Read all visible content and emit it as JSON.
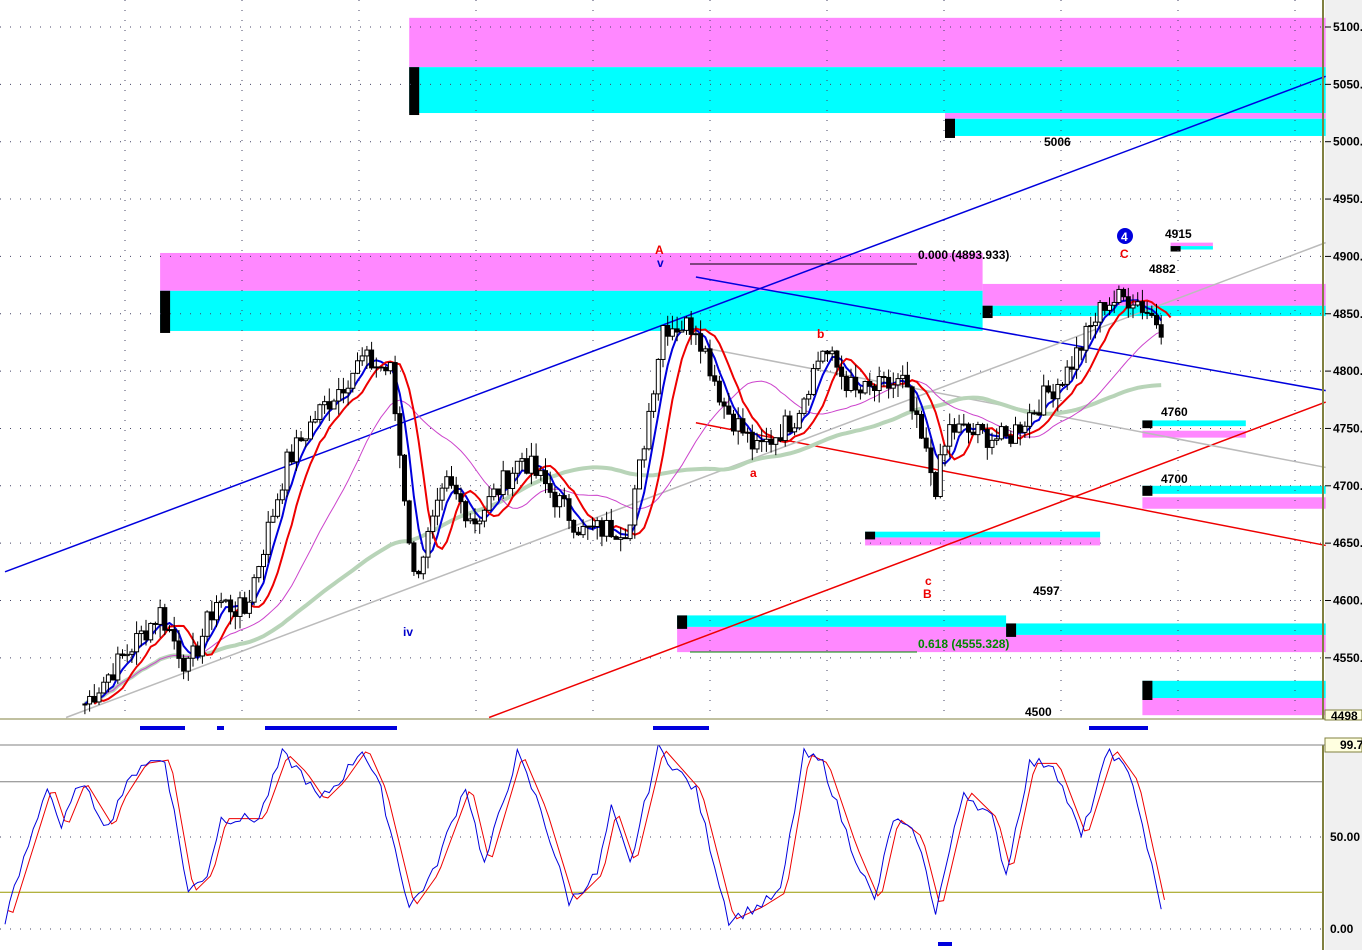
{
  "chart_data": {
    "type": "candlestick",
    "title": "",
    "price_axis": {
      "ylim": [
        4498,
        5108
      ],
      "ticks": [
        5100,
        5050,
        5000,
        4950,
        4900,
        4850,
        4800,
        4750,
        4700,
        4650,
        4600,
        4550
      ],
      "tick_labels": [
        "5100.",
        "5050.",
        "5000.",
        "4950.",
        "4900.",
        "4850.",
        "4800.",
        "4750.",
        "4700.",
        "4650.",
        "4600.",
        "4550."
      ],
      "last_label": "4498"
    },
    "price_waypoints": [
      [
        17,
        4510
      ],
      [
        33,
        4590
      ],
      [
        39,
        4540
      ],
      [
        45,
        4600
      ],
      [
        51,
        4590
      ],
      [
        60,
        4720
      ],
      [
        66,
        4760
      ],
      [
        76,
        4810
      ],
      [
        82,
        4800
      ],
      [
        87,
        4620
      ],
      [
        94,
        4700
      ],
      [
        100,
        4670
      ],
      [
        110,
        4725
      ],
      [
        123,
        4660
      ],
      [
        133,
        4665
      ],
      [
        140,
        4840
      ],
      [
        147,
        4840
      ],
      [
        153,
        4770
      ],
      [
        160,
        4730
      ],
      [
        168,
        4760
      ],
      [
        174,
        4820
      ],
      [
        181,
        4780
      ],
      [
        191,
        4790
      ],
      [
        198,
        4700
      ],
      [
        201,
        4750
      ],
      [
        213,
        4740
      ],
      [
        226,
        4800
      ],
      [
        234,
        4860
      ],
      [
        240,
        4865
      ],
      [
        246,
        4840
      ]
    ],
    "trendlines": [
      {
        "color": "#0000dd",
        "from": [
          0,
          4625
        ],
        "to": [
          281,
          5057
        ]
      },
      {
        "color": "#0000dd",
        "from": [
          147,
          4882
        ],
        "to": [
          281,
          4783
        ]
      },
      {
        "color": "#ee0000",
        "from": [
          103,
          4498
        ],
        "to": [
          281,
          4773
        ]
      },
      {
        "color": "#ee0000",
        "from": [
          147,
          4755
        ],
        "to": [
          281,
          4648
        ]
      },
      {
        "color": "#bbbbbb",
        "from": [
          13,
          4498
        ],
        "to": [
          281,
          4912
        ]
      },
      {
        "color": "#bbbbbb",
        "from": [
          149,
          4820
        ],
        "to": [
          281,
          4716
        ]
      }
    ],
    "zones": [
      {
        "bars": [
          86,
          281
        ],
        "magenta": [
          5108,
          5065
        ],
        "cyan": [
          5065,
          5025
        ]
      },
      {
        "bars": [
          200,
          281
        ],
        "magenta": [
          5025,
          5020
        ],
        "cyan": [
          5020,
          5005
        ]
      },
      {
        "bars": [
          33,
          208
        ],
        "magenta": [
          4903,
          4870
        ],
        "cyan": [
          4870,
          4835
        ]
      },
      {
        "bars": [
          208,
          281
        ],
        "magenta": [
          4876,
          4857
        ],
        "cyan": [
          4857,
          4848
        ]
      },
      {
        "bars": [
          143,
          213
        ],
        "magenta": [
          4577,
          4555
        ],
        "cyan": [
          4587,
          4577
        ]
      },
      {
        "bars": [
          213,
          281
        ],
        "magenta": [
          4570,
          4555
        ],
        "cyan": [
          4580,
          4570
        ]
      },
      {
        "bars": [
          183,
          233
        ],
        "magenta": [
          4655,
          4648
        ],
        "cyan": [
          4660,
          4655
        ]
      },
      {
        "bars": [
          242,
          281
        ],
        "magenta": [
          4690,
          4680
        ],
        "cyan": [
          4700,
          4693
        ]
      },
      {
        "bars": [
          242,
          264
        ],
        "magenta": [
          4748,
          4742
        ],
        "cyan": [
          4757,
          4752
        ]
      },
      {
        "bars": [
          242,
          281
        ],
        "magenta": [
          4515,
          4500
        ],
        "cyan": [
          4530,
          4515
        ]
      },
      {
        "bars": [
          248,
          257
        ],
        "magenta": [
          4912,
          4909
        ],
        "cyan": [
          4909,
          4906
        ]
      }
    ],
    "level_labels": [
      "5006",
      "4915",
      "4882",
      "4760",
      "4700",
      "4597",
      "4500"
    ],
    "fib": {
      "top": "0.000 (4893.933)",
      "bottom": "0.618 (4555.328)"
    },
    "wave_labels": {
      "A": "A",
      "v": "v",
      "iv": "iv",
      "a": "a",
      "b": "b",
      "c": "c",
      "B": "B",
      "C": "C",
      "four": "4"
    },
    "stochastic": {
      "ylim": [
        0,
        100
      ],
      "ticks": [
        "50.00",
        "0.00"
      ],
      "current": "99.7",
      "levels": [
        80,
        20
      ],
      "waypoints": [
        [
          0,
          5
        ],
        [
          9,
          78
        ],
        [
          12,
          55
        ],
        [
          16,
          80
        ],
        [
          22,
          55
        ],
        [
          24,
          70
        ],
        [
          29,
          90
        ],
        [
          34,
          92
        ],
        [
          39,
          20
        ],
        [
          43,
          30
        ],
        [
          46,
          60
        ],
        [
          50,
          60
        ],
        [
          54,
          60
        ],
        [
          59,
          95
        ],
        [
          63,
          85
        ],
        [
          67,
          70
        ],
        [
          71,
          80
        ],
        [
          76,
          98
        ],
        [
          80,
          75
        ],
        [
          86,
          12
        ],
        [
          91,
          30
        ],
        [
          98,
          78
        ],
        [
          102,
          35
        ],
        [
          109,
          95
        ],
        [
          114,
          65
        ],
        [
          120,
          15
        ],
        [
          126,
          30
        ],
        [
          129,
          65
        ],
        [
          133,
          35
        ],
        [
          139,
          98
        ],
        [
          147,
          75
        ],
        [
          154,
          5
        ],
        [
          160,
          12
        ],
        [
          165,
          20
        ],
        [
          170,
          95
        ],
        [
          174,
          90
        ],
        [
          180,
          45
        ],
        [
          185,
          15
        ],
        [
          189,
          60
        ],
        [
          194,
          50
        ],
        [
          198,
          10
        ],
        [
          204,
          75
        ],
        [
          210,
          60
        ],
        [
          213,
          30
        ],
        [
          218,
          90
        ],
        [
          223,
          90
        ],
        [
          229,
          50
        ],
        [
          235,
          98
        ],
        [
          240,
          80
        ],
        [
          246,
          10
        ]
      ]
    }
  },
  "colors": {
    "magenta": "#ff88ff",
    "cyan": "#00ffff",
    "blue": "#0000dd",
    "red": "#ee0000",
    "ma_long": "#b8d4b8",
    "ma_mid": "#cc44cc"
  }
}
